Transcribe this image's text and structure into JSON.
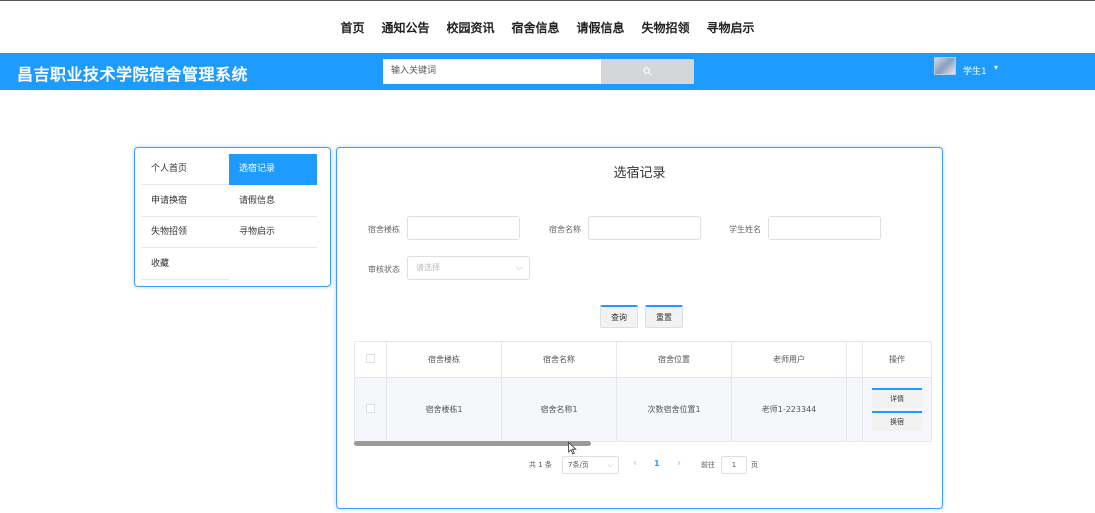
{
  "topnav": [
    "首页",
    "通知公告",
    "校园资讯",
    "宿舍信息",
    "请假信息",
    "失物招领",
    "寻物启示"
  ],
  "header": {
    "site_title": "昌吉职业技术学院宿舍管理系统",
    "search_placeholder": "输入关键词",
    "search_button_icon": "search-icon",
    "user_name": "学生1",
    "user_caret": "▾"
  },
  "sidemenu": {
    "items": [
      "个人首页",
      "选宿记录",
      "申请换宿",
      "请假信息",
      "失物招领",
      "寻物启示",
      "收藏"
    ],
    "active": "选宿记录"
  },
  "panel": {
    "title": "选宿记录",
    "filters": {
      "building_label": "宿舍楼栋",
      "room_label": "宿舍名称",
      "student_label": "学生姓名",
      "status_label": "审核状态",
      "status_placeholder": "请选择"
    },
    "buttons": {
      "query": "查询",
      "reset": "重置"
    },
    "table": {
      "columns": [
        "宿舍楼栋",
        "宿舍名称",
        "宿舍位置",
        "老师用户",
        "",
        "操作"
      ],
      "rows": [
        {
          "building": "宿舍楼栋1",
          "room": "宿舍名称1",
          "location": "次数宿舍位置1",
          "teacher": "老师1-223344",
          "actions": [
            "详情",
            "换宿"
          ]
        }
      ]
    },
    "pagination": {
      "total": "共 1 条",
      "page_size": "7条/页",
      "prev": "‹",
      "current_page": "1",
      "next": "›",
      "goto_label": "前往",
      "goto_value": "1",
      "goto_suffix": "页"
    }
  },
  "colors": {
    "primary": "#1e9bff",
    "border": "#409eff"
  }
}
